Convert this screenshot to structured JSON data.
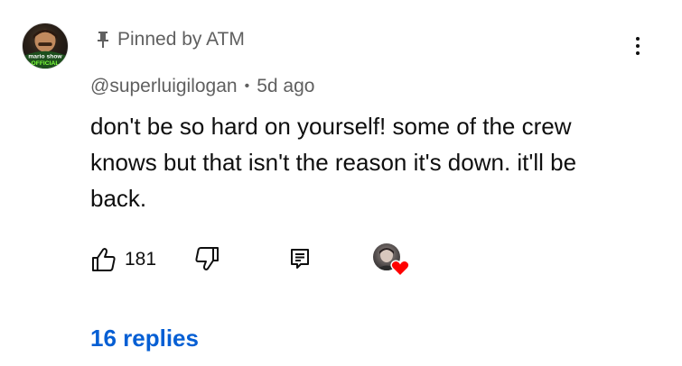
{
  "comment": {
    "pinned_label": "Pinned by ATM",
    "author": "@superluigilogan",
    "separator": "•",
    "timestamp": "5d ago",
    "text": "don't be so hard on yourself! some of the crew knows but that isn't the reason it's down. it'll be back.",
    "avatar_text": {
      "line1": "mario show",
      "line2": "OFFICIAL"
    }
  },
  "actions": {
    "like_count": "181",
    "like_icon": "thumb-up-icon",
    "dislike_icon": "thumb-down-icon",
    "reply_icon": "reply-icon",
    "creator_heart_icon": "heart-icon"
  },
  "replies": {
    "label": "16 replies"
  },
  "colors": {
    "link": "#065fd4",
    "muted": "#606060",
    "text": "#0f0f0f",
    "heart": "#ff0000"
  }
}
